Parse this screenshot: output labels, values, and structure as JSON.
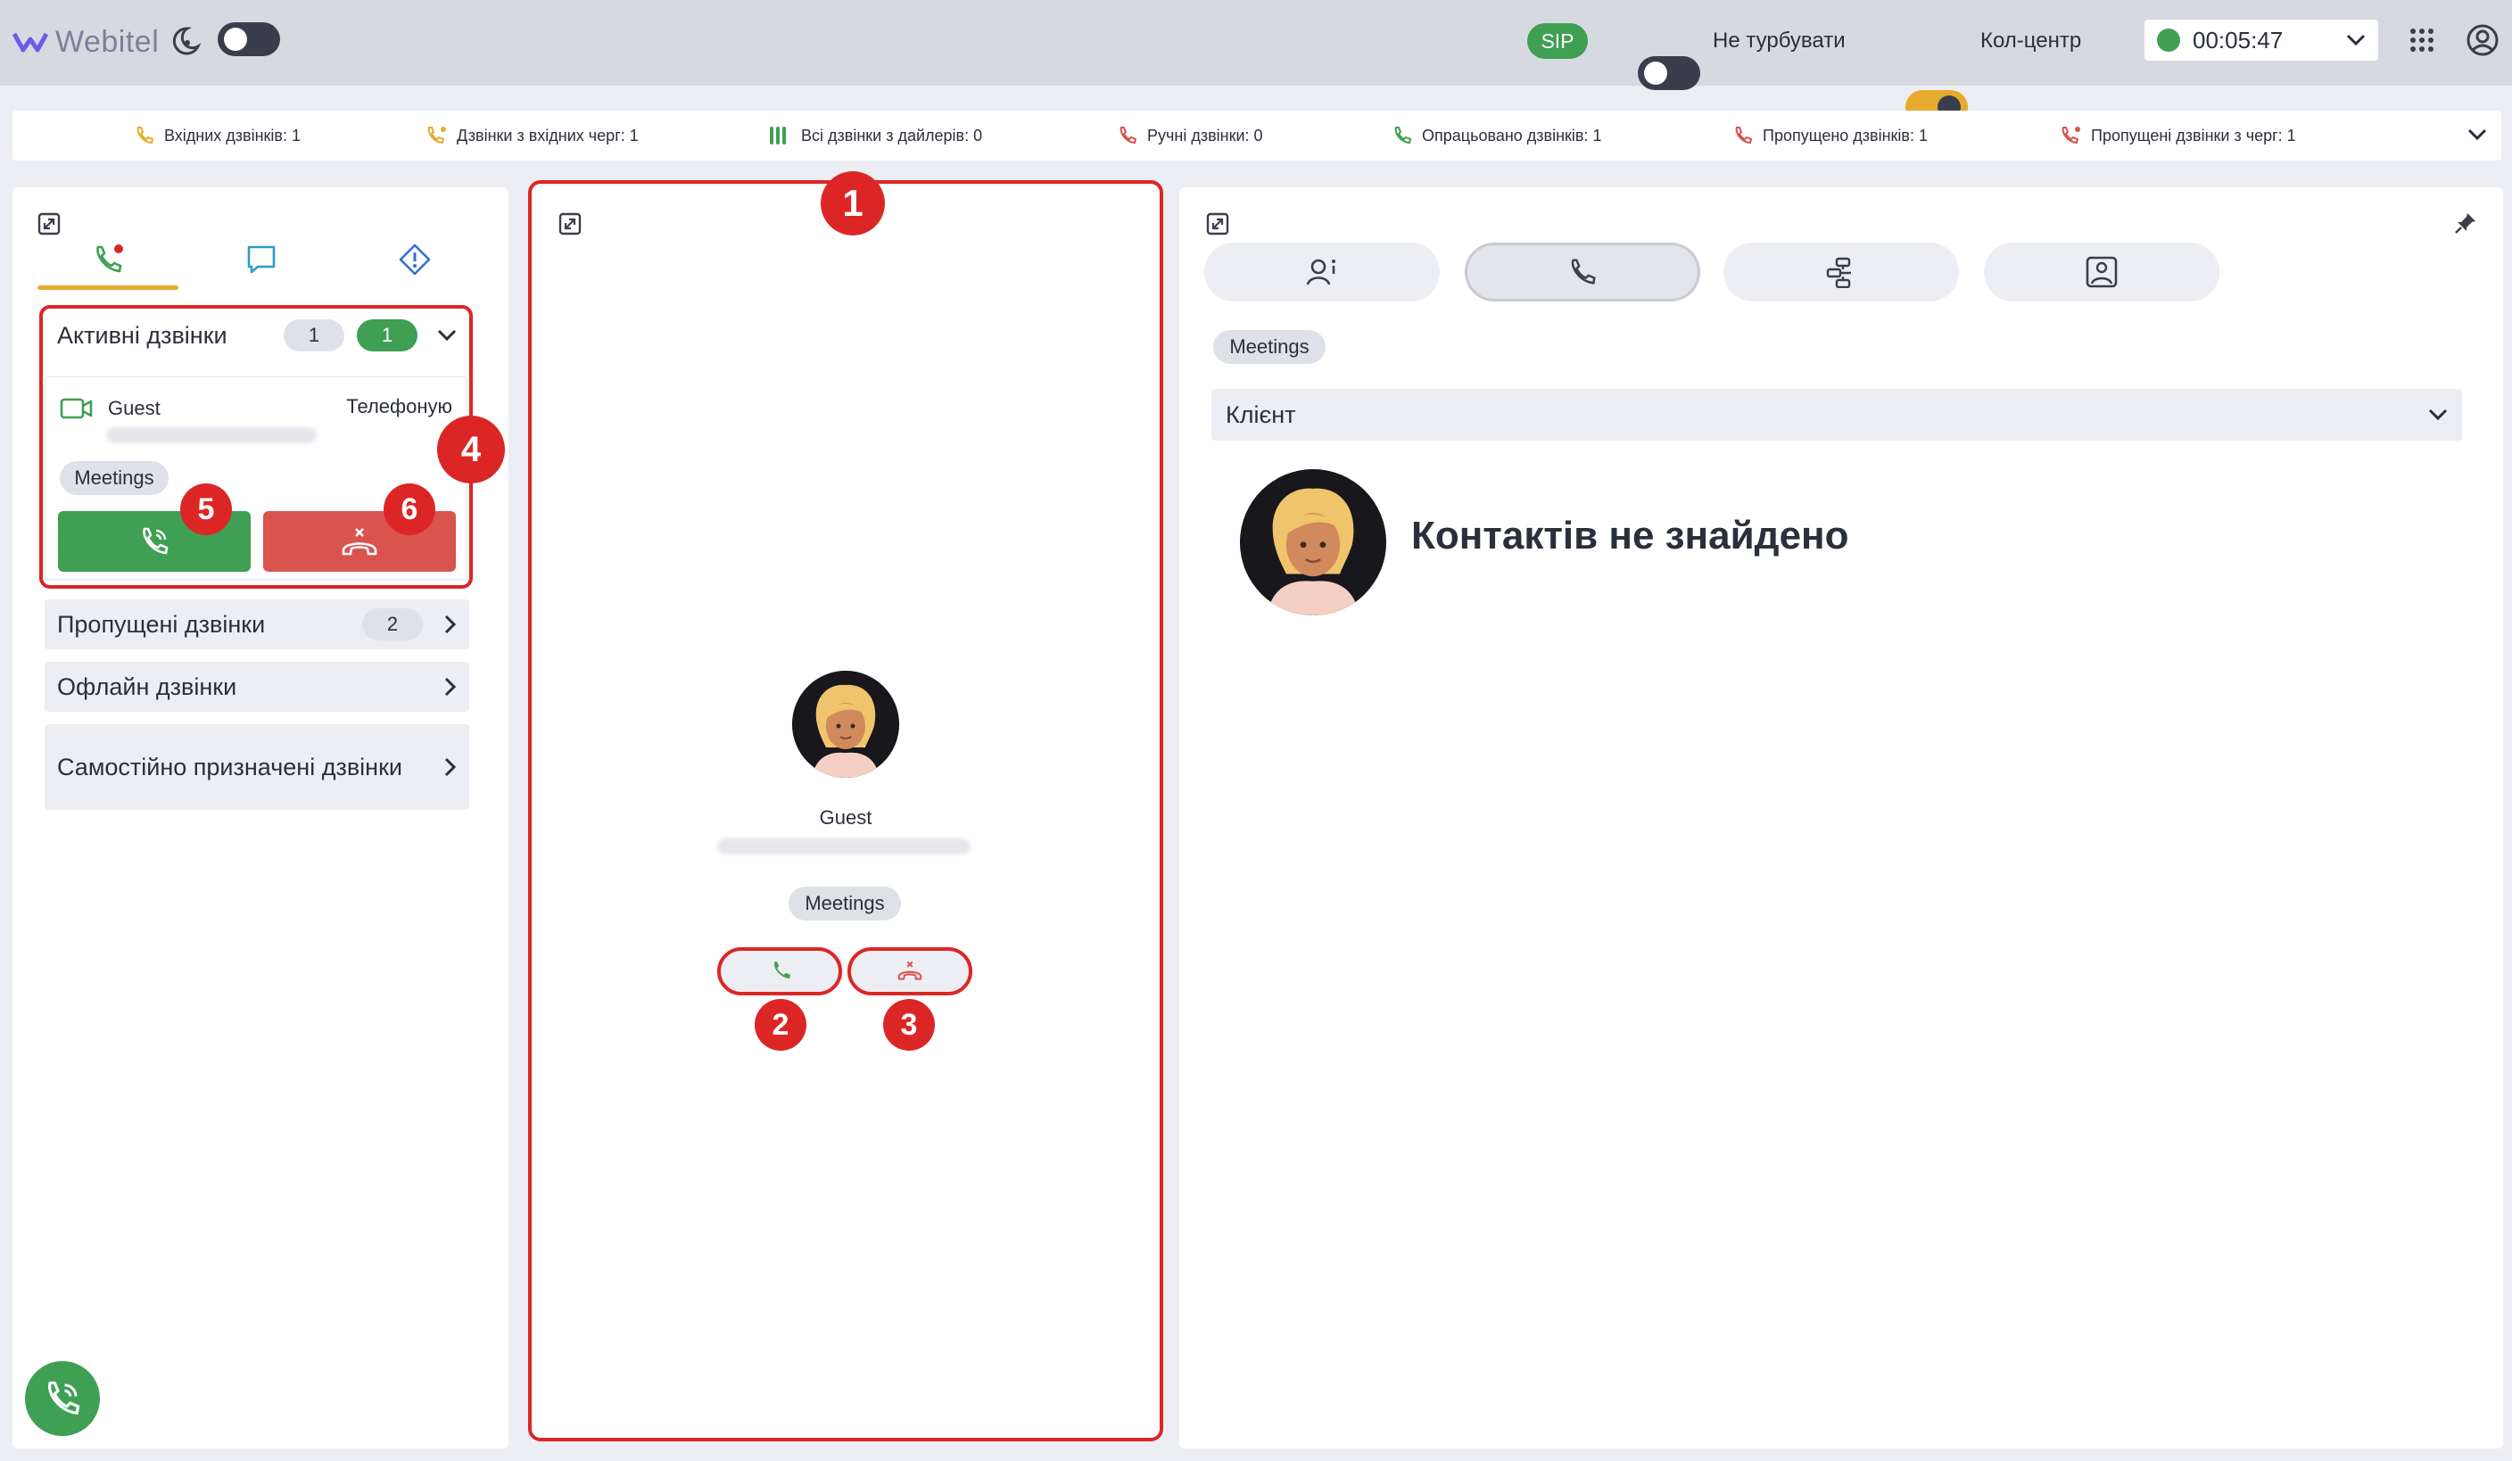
{
  "app": {
    "logo_text": "Webitel",
    "brand_color": "#6b5ce7"
  },
  "topbar": {
    "sip_label": "SIP",
    "dnd_label": "Не турбувати",
    "dnd_on": false,
    "callcenter_label": "Кол-центр",
    "callcenter_on": true,
    "timer": "00:05:47",
    "status_color": "#3f9f52"
  },
  "stats": [
    {
      "label": "Вхідних дзвінків: 1",
      "icon": "incoming-call-icon",
      "color": "#e6ab2e"
    },
    {
      "label": "Дзвінки з вхідних черг: 1",
      "icon": "queue-call-icon",
      "color": "#e6ab2e"
    },
    {
      "label": "Всі дзвінки з дайлерів: 0",
      "icon": "dialer-icon",
      "color": "#3f9f52"
    },
    {
      "label": "Ручні дзвінки: 0",
      "icon": "manual-call-icon",
      "color": "#d9534f"
    },
    {
      "label": "Опрацьовано дзвінків: 1",
      "icon": "processed-call-icon",
      "color": "#3f9f52"
    },
    {
      "label": "Пропущено дзвінків: 1",
      "icon": "missed-call-icon",
      "color": "#d9534f"
    },
    {
      "label": "Пропущені дзвінки з черг: 1",
      "icon": "missed-queue-call-icon",
      "color": "#d9534f"
    }
  ],
  "left": {
    "active_calls": {
      "title": "Активні дзвінки",
      "count_total": "1",
      "count_active": "1"
    },
    "call": {
      "name": "Guest",
      "status": "Телефоную",
      "tag": "Meetings"
    },
    "missed_calls": {
      "title": "Пропущені дзвінки",
      "count": "2"
    },
    "offline_calls": {
      "title": "Офлайн дзвінки"
    },
    "self_assigned": {
      "title": "Самостійно призначені дзвінки"
    }
  },
  "middle": {
    "name": "Guest",
    "tag": "Meetings"
  },
  "right": {
    "tag": "Meetings",
    "client_label": "Клієнт",
    "no_contacts": "Контактів не знайдено"
  },
  "markers": [
    "1",
    "2",
    "3",
    "4",
    "5",
    "6"
  ],
  "colors": {
    "accent_yellow": "#e6ab2e",
    "green": "#3f9f52",
    "red": "#d9534f",
    "annotation_red": "#dc2626"
  }
}
